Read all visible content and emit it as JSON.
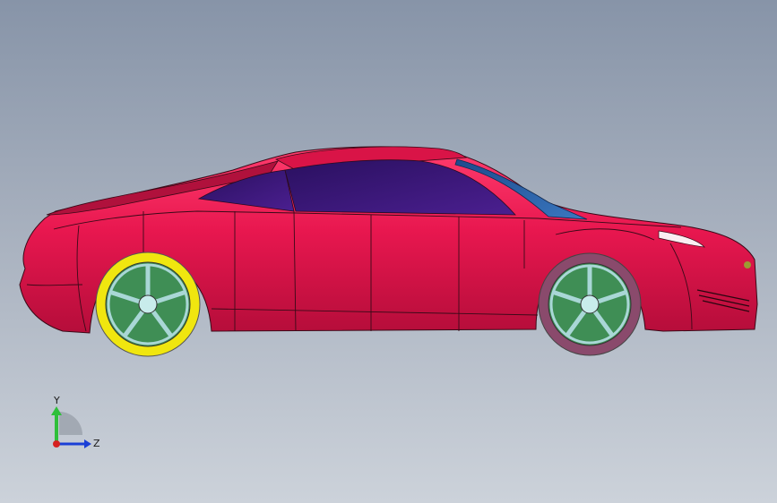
{
  "viewport": {
    "background_top": "#8794a8",
    "background_bottom": "#ccd2da"
  },
  "model": {
    "description_icon": "car-3d-model",
    "body_color": "#e8174f",
    "glass_color": "#3d1a80",
    "windshield_color": "#2b5fa8",
    "rear_wheel_tire_color": "#f0e60f",
    "front_wheel_tire_color": "#8a4a6c",
    "rim_color": "#a9d7d6",
    "brake_color": "#3f8e55"
  },
  "triad": {
    "y_label": "Y",
    "z_label": "Z",
    "y_color": "#2fbf3a",
    "z_color": "#1a3fd6",
    "x_color": "#d62020"
  }
}
